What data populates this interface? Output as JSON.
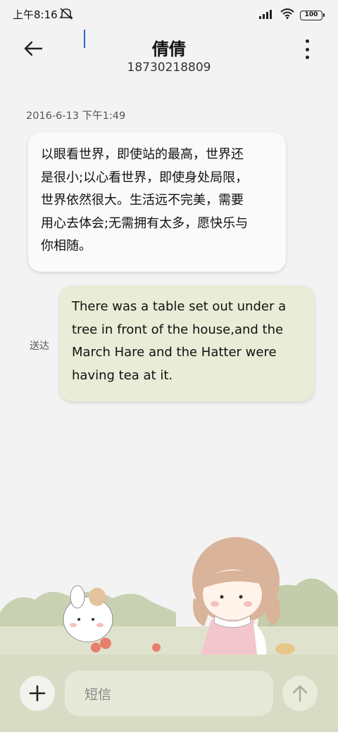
{
  "status_bar": {
    "time": "上午8:16",
    "battery": "100",
    "icons": [
      "mute-icon",
      "signal-icon",
      "wifi-icon",
      "battery-icon"
    ]
  },
  "header": {
    "contact_name": "倩倩",
    "contact_number": "18730218809",
    "icons": [
      "back-arrow-icon",
      "more-vertical-icon"
    ]
  },
  "conversation": {
    "timestamp": "2016-6-13 下午1:49",
    "incoming_lines": [
      "以眼看世界，即使站的最高，世界还",
      "是很小;以心看世界，即使身处局限，",
      "世界依然很大。生活远不完美，需要",
      "用心去体会;无需拥有太多，愿快乐与",
      "你相随。"
    ],
    "outgoing_lines": [
      "There was a table set out under a",
      "tree in front of the house,and the",
      "March Hare and the Hatter were",
      "having tea at it."
    ],
    "delivery_status": "送达"
  },
  "composer": {
    "input_placeholder": "短信",
    "icons": [
      "plus-icon",
      "send-arrow-icon"
    ]
  },
  "colors": {
    "background": "#f3f3f3",
    "incoming_bubble": "#fafafa",
    "outgoing_bubble": "#e9ecd6",
    "composer_bar": "#d9dcc4",
    "caret": "#2a62d6"
  }
}
